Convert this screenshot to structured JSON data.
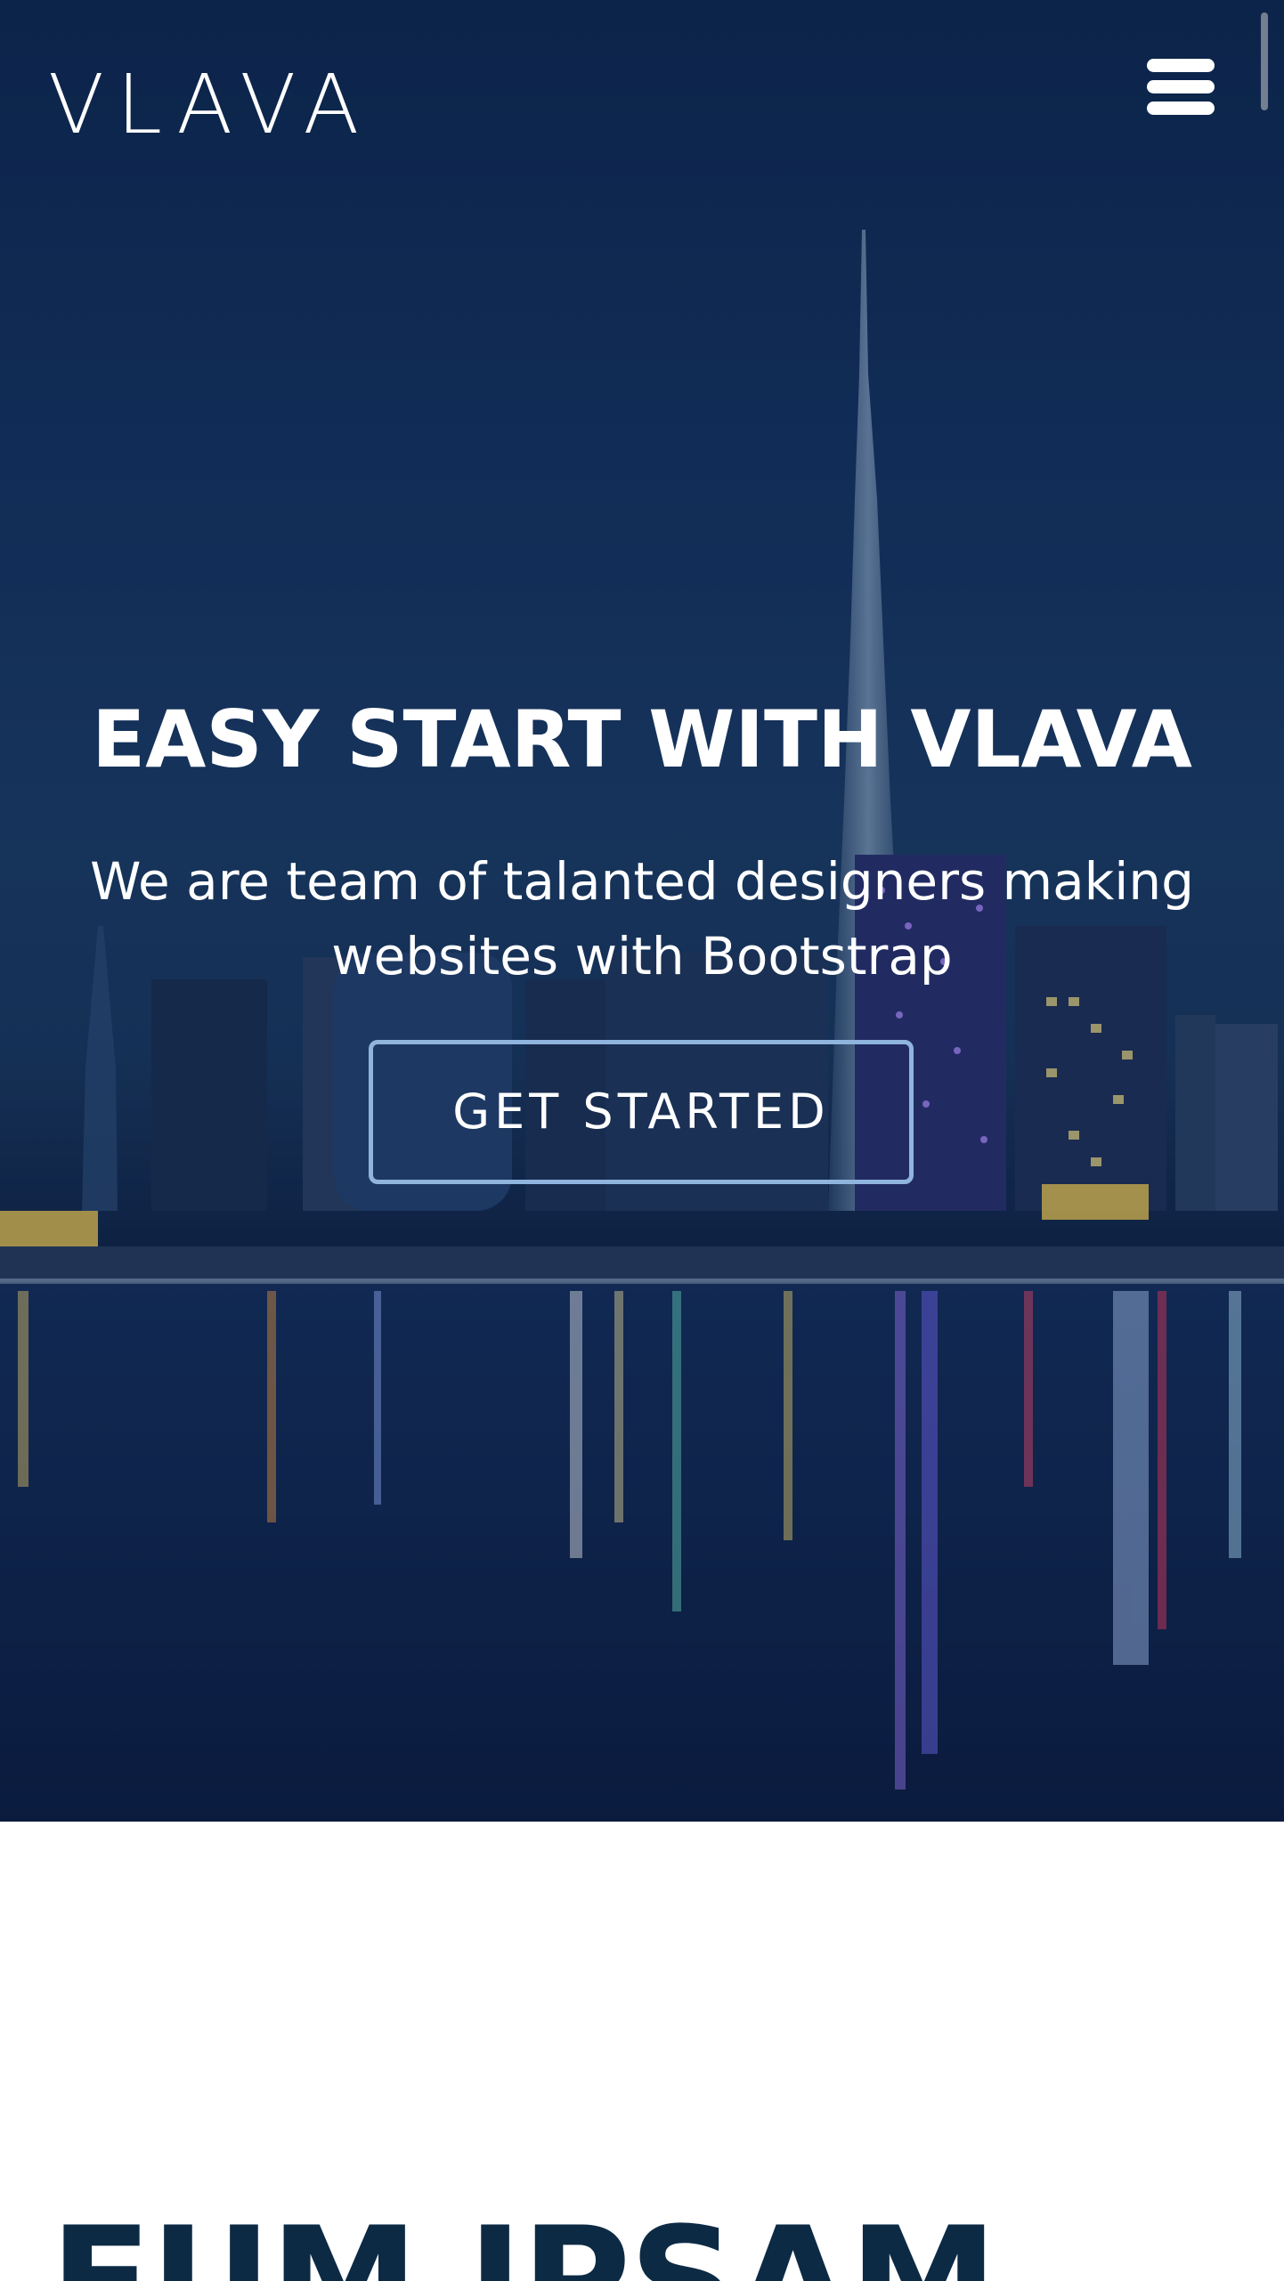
{
  "header": {
    "logo_text": "VLAVA",
    "menu_icon": "hamburger-menu-icon"
  },
  "hero": {
    "title": "EASY START WITH VLAVA",
    "subtitle": "We are team of talanted designers making websites with Bootstrap",
    "cta_label": "GET STARTED",
    "background": "night city skyline with water reflections",
    "accent_border_color": "#8fb4de"
  },
  "section": {
    "heading": "EUM IPSAM",
    "heading_color": "#0d2a45"
  }
}
